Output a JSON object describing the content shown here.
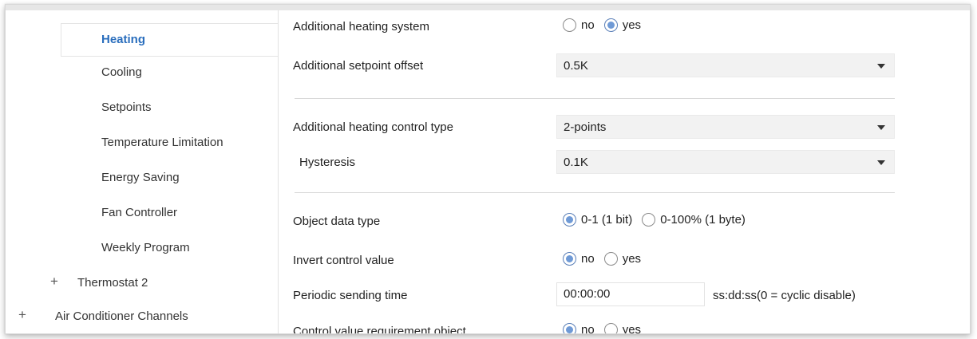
{
  "sidebar": {
    "items": [
      {
        "label": "Heating",
        "active": true
      },
      {
        "label": "Cooling"
      },
      {
        "label": "Setpoints"
      },
      {
        "label": "Temperature Limitation"
      },
      {
        "label": "Energy Saving"
      },
      {
        "label": "Fan Controller"
      },
      {
        "label": "Weekly Program"
      }
    ],
    "groups": [
      {
        "label": "Thermostat 2",
        "icon": "plus-icon"
      },
      {
        "label": "Air Conditioner Channels",
        "icon": "plus-icon"
      }
    ]
  },
  "form": {
    "additional_heating_system": {
      "label": "Additional heating system",
      "options": [
        "no",
        "yes"
      ],
      "selected": "yes"
    },
    "additional_setpoint_offset": {
      "label": "Additional setpoint offset",
      "value": "0.5K"
    },
    "control_type": {
      "label": "Additional heating control type",
      "value": "2-points"
    },
    "hysteresis": {
      "label": "Hysteresis",
      "value": "0.1K"
    },
    "object_data_type": {
      "label": "Object data type",
      "options": [
        "0-1 (1 bit)",
        "0-100% (1 byte)"
      ],
      "selected": "0-1 (1 bit)"
    },
    "invert_control_value": {
      "label": "Invert control value",
      "options": [
        "no",
        "yes"
      ],
      "selected": "no"
    },
    "periodic_sending_time": {
      "label": "Periodic sending time",
      "value": "00:00:00",
      "hint": "ss:dd:ss(0 = cyclic disable)"
    },
    "control_value_requirement": {
      "label": "Control value requirement object",
      "options": [
        "no",
        "yes"
      ],
      "selected": "no"
    }
  },
  "colors": {
    "accent": "#2a6ebd",
    "radio_fill": "#6f9ad6",
    "select_bg": "#f2f2f2"
  }
}
